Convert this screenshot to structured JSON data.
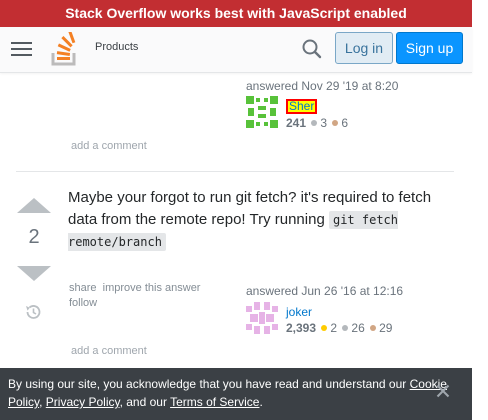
{
  "banner": {
    "text": "Stack Overflow works best with JavaScript enabled"
  },
  "topbar": {
    "menu_icon": "hamburger-icon",
    "logo_icon": "stackoverflow-logo",
    "products_label": "Products",
    "search_icon": "search-icon",
    "login_label": "Log in",
    "signup_label": "Sign up"
  },
  "answer1": {
    "answered": "answered Nov 29 '19 at 8:20",
    "user": "Sher",
    "reputation": "241",
    "silver": "3",
    "bronze": "6",
    "add_comment": "add a comment"
  },
  "answer2": {
    "score": "2",
    "body_text_1": "Maybe your forgot to run git fetch? it's required to fetch data from the remote repo! Try running ",
    "code": "git fetch remote/branch",
    "menu": {
      "share": "share",
      "improve": "improve this answer",
      "follow": "follow"
    },
    "answered": "answered Jun 26 '16 at 12:16",
    "user": "joker",
    "reputation": "2,393",
    "gold": "2",
    "silver": "26",
    "bronze": "29",
    "add_comment": "add a comment"
  },
  "cookie": {
    "text_1": "By using our site, you acknowledge that you have read and understand our ",
    "cookie_policy": "Cookie Policy",
    "sep": ", ",
    "privacy_policy": "Privacy Policy",
    "text_2": ", and our ",
    "terms": "Terms of Service",
    "text_3": "."
  },
  "colors": {
    "banner": "#c22e32",
    "accent": "#0a95ff",
    "gold": "#ffcc01",
    "silver": "#b4b8bc",
    "bronze": "#d1a684"
  }
}
